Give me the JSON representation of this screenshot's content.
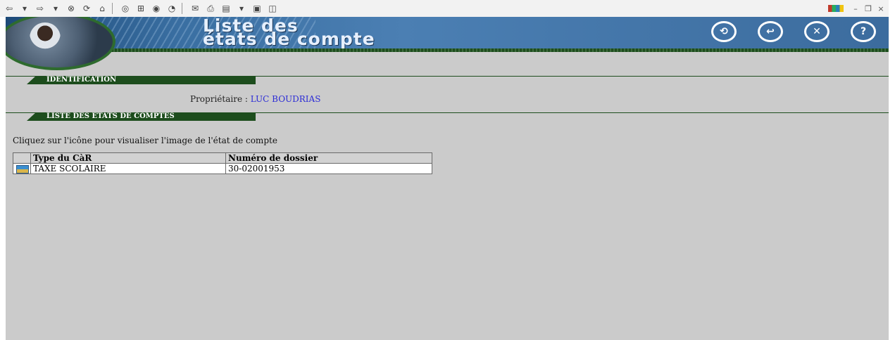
{
  "toolbar": {
    "icons": [
      "back-icon",
      "forward-icon",
      "stop-icon",
      "refresh-icon",
      "home-icon",
      "search-icon",
      "favorites-icon",
      "history-icon",
      "mail-icon",
      "print-icon",
      "edit-icon",
      "discuss-icon"
    ]
  },
  "header": {
    "title_line1": "Liste des",
    "title_line2": "états de compte",
    "buttons": [
      "refresh-icon",
      "back-icon",
      "close-icon",
      "help-icon"
    ]
  },
  "sections": {
    "identification": "IDENTIFICATION",
    "liste": "LISTE DES ÉTATS DE COMPTES"
  },
  "owner": {
    "label": "Propriétaire :",
    "value": "LUC BOUDRIAS"
  },
  "instruction": "Cliquez sur l'icône pour visualiser l'image de l'état de compte",
  "table": {
    "headers": [
      "Type du CàR",
      "Numéro de dossier"
    ],
    "rows": [
      {
        "type": "TAXE SCOLAIRE",
        "numero": "30-02001953"
      }
    ]
  },
  "colors": {
    "header_blue": "#3a6fa2",
    "section_green": "#1d4d1d",
    "link_blue": "#2b2bd6",
    "background": "#cbcbcb"
  }
}
